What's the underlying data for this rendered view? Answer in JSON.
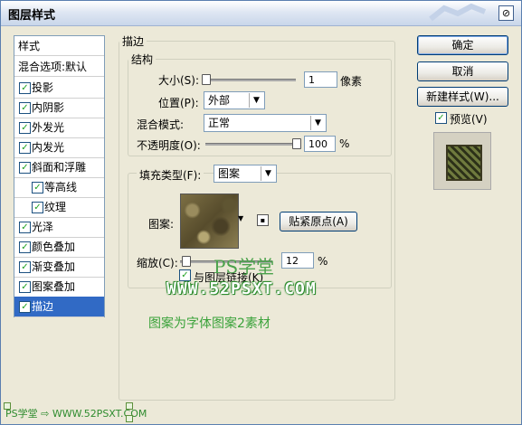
{
  "window": {
    "title": "图层样式"
  },
  "left_panel": {
    "header": "样式",
    "blend_options": "混合选项:默认",
    "items": [
      {
        "label": "投影",
        "checked": true,
        "indent": false
      },
      {
        "label": "内阴影",
        "checked": true,
        "indent": false
      },
      {
        "label": "外发光",
        "checked": true,
        "indent": false
      },
      {
        "label": "内发光",
        "checked": true,
        "indent": false
      },
      {
        "label": "斜面和浮雕",
        "checked": true,
        "indent": false
      },
      {
        "label": "等高线",
        "checked": true,
        "indent": true
      },
      {
        "label": "纹理",
        "checked": true,
        "indent": true
      },
      {
        "label": "光泽",
        "checked": true,
        "indent": false
      },
      {
        "label": "颜色叠加",
        "checked": true,
        "indent": false
      },
      {
        "label": "渐变叠加",
        "checked": true,
        "indent": false
      },
      {
        "label": "图案叠加",
        "checked": true,
        "indent": false
      },
      {
        "label": "描边",
        "checked": true,
        "indent": false,
        "selected": true
      }
    ]
  },
  "stroke": {
    "section_title": "描边",
    "structure_title": "结构",
    "size_label": "大小(S):",
    "size_value": "1",
    "size_unit": "像素",
    "position_label": "位置(P):",
    "position_value": "外部",
    "blend_label": "混合模式:",
    "blend_value": "正常",
    "opacity_label": "不透明度(O):",
    "opacity_value": "100",
    "opacity_unit": "%",
    "fill_type_label": "填充类型(F):",
    "fill_type_value": "图案",
    "pattern_label": "图案:",
    "snap_button": "贴紧原点(A)",
    "scale_label": "缩放(C):",
    "scale_value": "12",
    "scale_unit": "%",
    "link_label": "与图层链接(K)",
    "link_checked": true,
    "size_level": 0.0,
    "opacity_level": 1.0,
    "scale_level": 0.12
  },
  "right_panel": {
    "ok": "确定",
    "cancel": "取消",
    "new_style": "新建样式(W)...",
    "preview_label": "预览(V)",
    "preview_checked": true
  },
  "watermark": {
    "brand": "PS学堂",
    "url": "WWW.52PSXT.COM",
    "note": "图案为字体图案2素材",
    "corner": "PS学堂 ⇨ WWW.52PSXT.COM"
  },
  "colors": {
    "selection": "#316ac5",
    "watermark_green": "#3aa23a",
    "border_blue": "#5a7fb0"
  }
}
